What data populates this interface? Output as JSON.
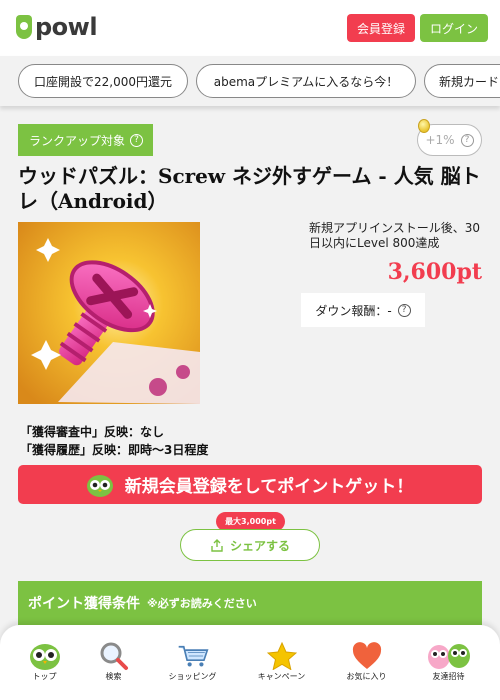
{
  "header": {
    "logo_text": "powl",
    "register_label": "会員登録",
    "login_label": "ログイン"
  },
  "chips": [
    {
      "label": "口座開設で22,000円還元"
    },
    {
      "label": "abemaプレミアムに入るなら今！"
    },
    {
      "label": "新規カード"
    }
  ],
  "offer": {
    "rank_label": "ランクアップ対象",
    "bonus_label": "+1%",
    "title": "ウッドパズル：Screw ネジ外すゲーム - 人気 脳トレ（Android）",
    "condition": "新規アプリインストール後、30日以内にLevel 800達成",
    "points": "3,600pt",
    "down_reward": "ダウン報酬：-",
    "status_review": "「獲得審査中」反映：なし",
    "status_history": "「獲得履歴」反映：即時～3日程度"
  },
  "cta": {
    "label": "新規会員登録をしてポイントゲット！"
  },
  "share": {
    "max_badge": "最大3,000pt",
    "label": "シェアする"
  },
  "conditions_section": {
    "title": "ポイント獲得条件",
    "note": "※必ずお読みください"
  },
  "bottom_nav": [
    {
      "label": "トップ",
      "icon": "owl-icon"
    },
    {
      "label": "検索",
      "icon": "magnifier-icon"
    },
    {
      "label": "ショッピング",
      "icon": "cart-icon"
    },
    {
      "label": "キャンペーン",
      "icon": "star-icon"
    },
    {
      "label": "お気に入り",
      "icon": "heart-icon"
    },
    {
      "label": "友達招待",
      "icon": "owl-friends-icon"
    }
  ],
  "colors": {
    "brand_green": "#7cc242",
    "accent_red": "#f23d4f",
    "background": "#f2f2f2"
  }
}
